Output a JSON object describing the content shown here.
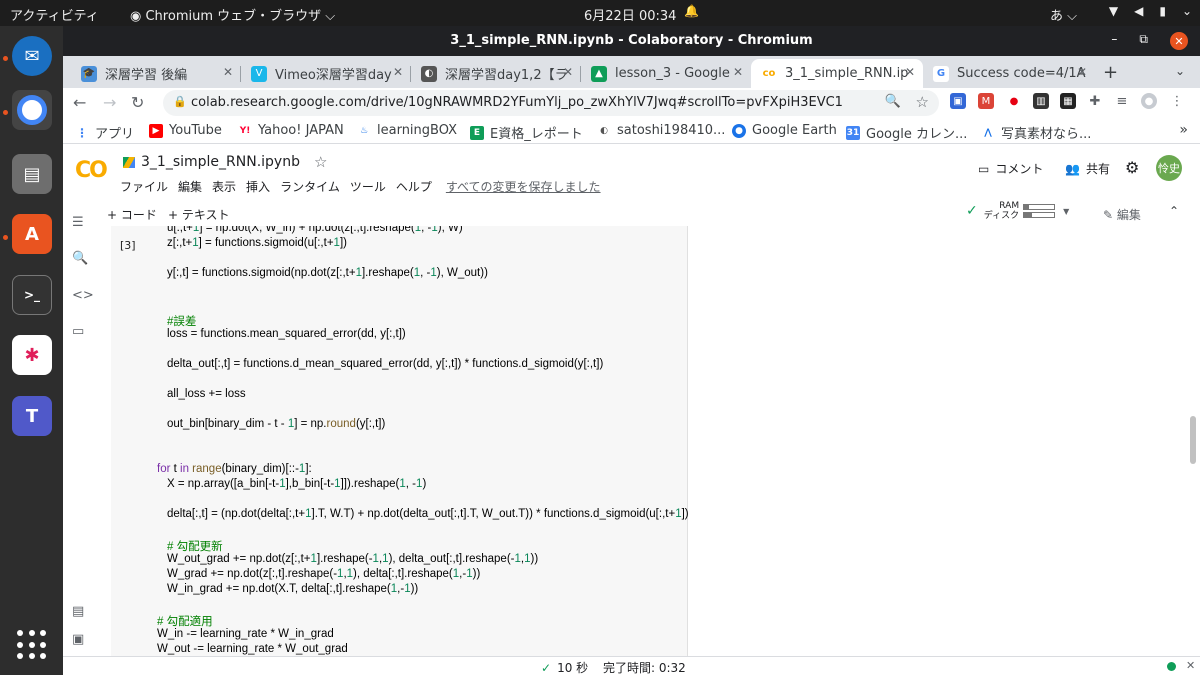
{
  "os": {
    "activities": "アクティビティ",
    "app": "Chromium ウェブ・ブラウザ ⌵",
    "clock": "6月22日 00:34",
    "ime": "あ ⌵"
  },
  "window": {
    "title": "3_1_simple_RNN.ipynb - Colaboratory - Chromium",
    "minimize": "–",
    "maximize": "⧉",
    "close": "✕"
  },
  "tabs": [
    {
      "label": "深層学習 後編",
      "icon": "graduation-icon",
      "color": "#4a90d9"
    },
    {
      "label": "Vimeo深層学習day",
      "icon": "vimeo-icon",
      "color": "#1ab7ea"
    },
    {
      "label": "深層学習day1,2【ラ",
      "icon": "github-icon",
      "color": "#555555"
    },
    {
      "label": "lesson_3 - Google",
      "icon": "drive-icon",
      "color": "#0f9d58"
    },
    {
      "label": "3_1_simple_RNN.ip",
      "icon": "colab-icon",
      "color": "#f9ab00"
    },
    {
      "label": "Success code=4/1A",
      "icon": "google-icon",
      "color": "#4285f4"
    }
  ],
  "address": {
    "url": "colab.research.google.com/drive/10gNRAWMRD2YFumYlj_po_zwXhYlV7Jwq#scrollTo=pvFXpiH3EVC1"
  },
  "bookmarks": [
    {
      "label": "アプリ",
      "icon": "apps-icon",
      "color": "#4285f4"
    },
    {
      "label": "YouTube",
      "icon": "youtube-icon",
      "color": "#ff0000"
    },
    {
      "label": "Yahoo! JAPAN",
      "icon": "yahoo-icon",
      "color": "#ff0033"
    },
    {
      "label": "learningBOX",
      "icon": "learningbox-icon",
      "color": "#1a73e8"
    },
    {
      "label": "E資格_レポート",
      "icon": "e-icon",
      "color": "#0f9d58"
    },
    {
      "label": "satoshi198410...",
      "icon": "github-icon",
      "color": "#555555"
    },
    {
      "label": "Google Earth",
      "icon": "earth-icon",
      "color": "#1a73e8"
    },
    {
      "label": "Google カレン...",
      "icon": "calendar-icon",
      "color": "#4285f4"
    },
    {
      "label": "写真素材なら...",
      "icon": "photo-icon",
      "color": "#1a73e8"
    }
  ],
  "colab": {
    "logo": "CO",
    "notebook": "3_1_simple_RNN.ipynb",
    "menu": [
      "ファイル",
      "編集",
      "表示",
      "挿入",
      "ランタイム",
      "ツール",
      "ヘルプ"
    ],
    "saved": "すべての変更を保存しました",
    "comment": "コメント",
    "share": "共有",
    "avatar": "怜史",
    "add_code": "+ コード",
    "add_text": "+ テキスト",
    "ram": "RAM",
    "disk": "ディスク",
    "ram_usage": 0.15,
    "disk_usage": 0.25,
    "edit": "編集"
  },
  "cell": {
    "exec_count": "[3]"
  },
  "status": {
    "elapsed": "10 秒",
    "finished": "完了時間: 0:32"
  }
}
